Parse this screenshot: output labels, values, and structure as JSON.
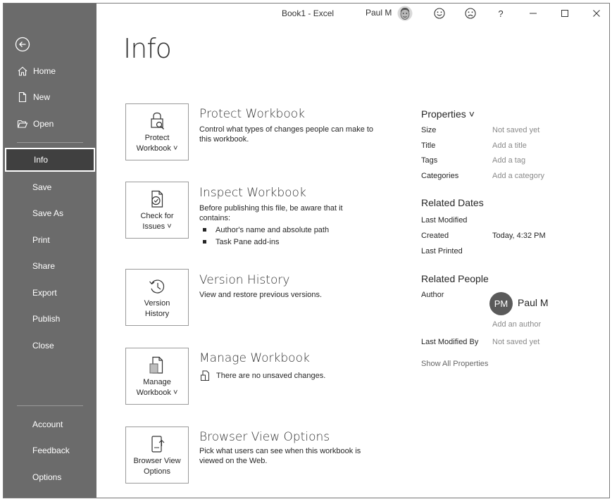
{
  "window": {
    "title": "Book1  -  Excel",
    "user": "Paul M"
  },
  "titlebar_icons": [
    "smile-icon",
    "frown-icon",
    "help-icon",
    "minimize-icon",
    "maximize-icon",
    "close-icon"
  ],
  "titlebar_glyphs": {
    "help": "?"
  },
  "sidebar": {
    "items": [
      {
        "label": "Home",
        "icon": "home-icon"
      },
      {
        "label": "New",
        "icon": "new-file-icon"
      },
      {
        "label": "Open",
        "icon": "folder-open-icon"
      },
      {
        "label": "Info"
      },
      {
        "label": "Save"
      },
      {
        "label": "Save As"
      },
      {
        "label": "Print"
      },
      {
        "label": "Share"
      },
      {
        "label": "Export"
      },
      {
        "label": "Publish"
      },
      {
        "label": "Close"
      },
      {
        "label": "Account"
      },
      {
        "label": "Feedback"
      },
      {
        "label": "Options"
      }
    ],
    "selected": "Info"
  },
  "page_title": "Info",
  "sections": [
    {
      "tile_lines": [
        "Protect",
        "Workbook ˅"
      ],
      "title": "Protect Workbook",
      "description": "Control what types of changes people can make to this workbook."
    },
    {
      "tile_lines": [
        "Check for",
        "Issues ˅"
      ],
      "title": "Inspect Workbook",
      "description": "Before publishing this file, be aware that it contains:",
      "bullets": [
        "Author's name and absolute path",
        "Task Pane add-ins"
      ]
    },
    {
      "tile_lines": [
        "Version",
        "History"
      ],
      "title": "Version History",
      "description": "View and restore previous versions."
    },
    {
      "tile_lines": [
        "Manage",
        "Workbook ˅"
      ],
      "title": "Manage Workbook",
      "description": "There are no unsaved changes."
    },
    {
      "tile_lines": [
        "Browser View",
        "Options"
      ],
      "title": "Browser View Options",
      "description": "Pick what users can see when this workbook is viewed on the Web."
    }
  ],
  "properties": {
    "heading": "Properties ˅",
    "rows": [
      {
        "label": "Size",
        "value": "Not saved yet"
      },
      {
        "label": "Title",
        "value": "Add a title"
      },
      {
        "label": "Tags",
        "value": "Add a tag"
      },
      {
        "label": "Categories",
        "value": "Add a category"
      }
    ]
  },
  "related_dates": {
    "heading": "Related Dates",
    "rows": [
      {
        "label": "Last Modified",
        "value": ""
      },
      {
        "label": "Created",
        "value": "Today, 4:32 PM"
      },
      {
        "label": "Last Printed",
        "value": ""
      }
    ]
  },
  "related_people": {
    "heading": "Related People",
    "author_label": "Author",
    "author_initials": "PM",
    "author_name": "Paul M",
    "add_author": "Add an author",
    "last_modified_by_label": "Last Modified By",
    "last_modified_by_value": "Not saved yet"
  },
  "show_all": "Show All Properties"
}
